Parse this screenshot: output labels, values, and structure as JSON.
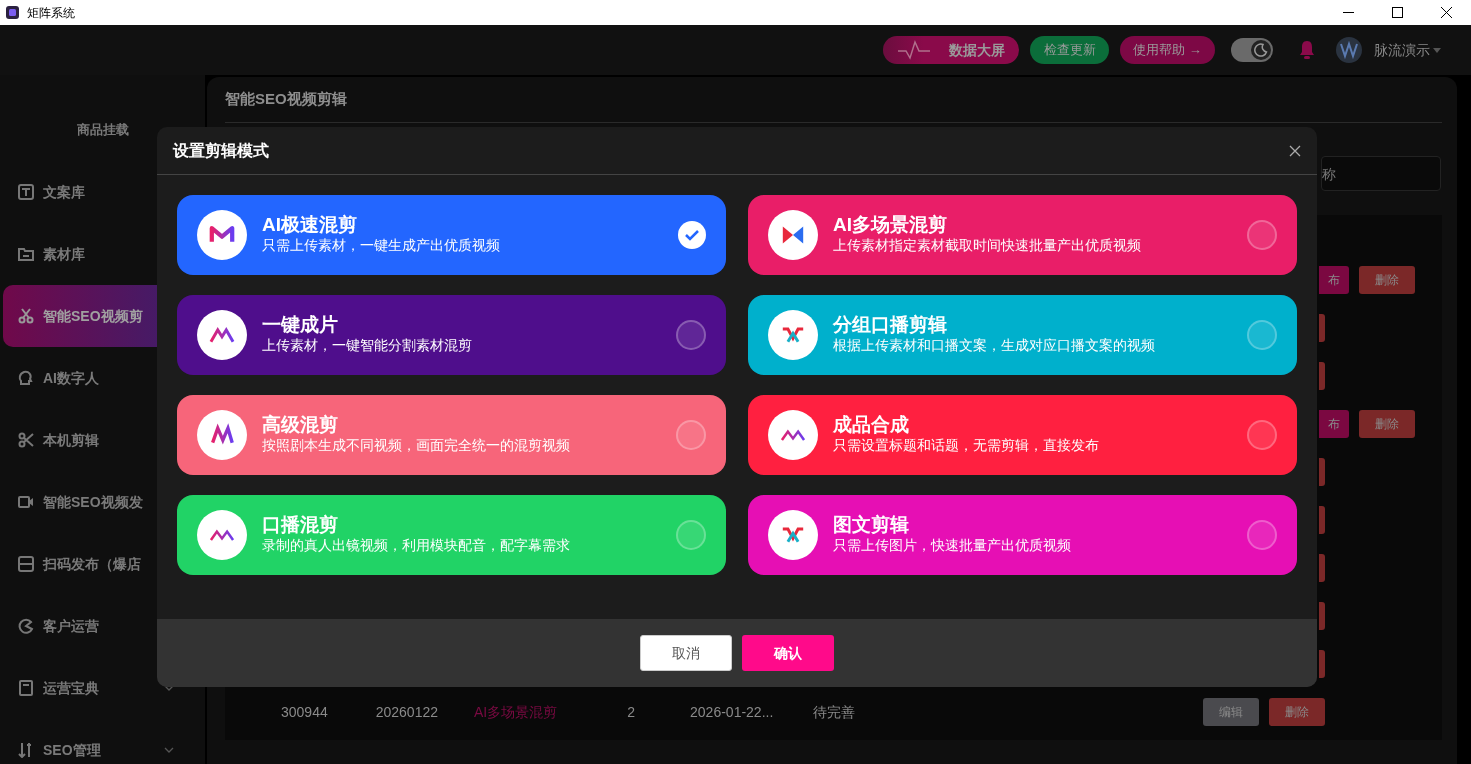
{
  "window": {
    "title": "矩阵系统"
  },
  "header": {
    "buttons": [
      {
        "label": "数据大屏",
        "kind": "dashboard"
      },
      {
        "label": "检查更新",
        "kind": "update"
      },
      {
        "label": "使用帮助 →",
        "kind": "help"
      }
    ],
    "dark_mode": true,
    "user": "脉流演示"
  },
  "sidebar": {
    "items": [
      {
        "label": "商品挂载",
        "kind": "heading",
        "selected": false
      },
      {
        "label": "文案库",
        "kind": "item",
        "selected": false
      },
      {
        "label": "素材库",
        "kind": "item",
        "selected": false
      },
      {
        "label": "智能SEO视频剪",
        "kind": "item",
        "selected": true
      },
      {
        "label": "AI数字人",
        "kind": "item",
        "selected": false
      },
      {
        "label": "本机剪辑",
        "kind": "item",
        "selected": false
      },
      {
        "label": "智能SEO视频发",
        "kind": "item",
        "selected": false
      },
      {
        "label": "扫码发布（爆店",
        "kind": "item",
        "selected": false
      },
      {
        "label": "客户运营",
        "kind": "item",
        "selected": false
      },
      {
        "label": "运营宝典",
        "kind": "group",
        "selected": false
      },
      {
        "label": "SEO管理",
        "kind": "group",
        "selected": false
      }
    ]
  },
  "page": {
    "title": "智能SEO视频剪辑",
    "search": {
      "placeholder": "称"
    },
    "rows": [
      {
        "kind": "publish",
        "buttons": [
          "布",
          "删除"
        ]
      },
      {
        "kind": "sliver"
      },
      {
        "kind": "sliver"
      },
      {
        "kind": "publish",
        "buttons": [
          "布",
          "删除"
        ]
      },
      {
        "kind": "sliver"
      },
      {
        "kind": "sliver"
      },
      {
        "kind": "sliver"
      },
      {
        "kind": "sliver"
      },
      {
        "kind": "sliver"
      },
      {
        "kind": "full",
        "cells": [
          "300944",
          "20260122",
          "AI多场景混剪",
          "2",
          "2026-01-22...",
          "待完善"
        ],
        "buttons": [
          "编辑",
          "删除"
        ]
      }
    ]
  },
  "dialog": {
    "title": "设置剪辑模式",
    "modes": [
      {
        "title": "AI极速混剪",
        "description": "只需上传素材，一键生成产出优质视频",
        "color": "#2366ff",
        "selected": true
      },
      {
        "title": "AI多场景混剪",
        "description": "上传素材指定素材截取时间快速批量产出优质视频",
        "color": "#e91e68",
        "selected": false
      },
      {
        "title": "一键成片",
        "description": "上传素材，一键智能分割素材混剪",
        "color": "#4f0e8c",
        "selected": false
      },
      {
        "title": "分组口播剪辑",
        "description": "根据上传素材和口播文案，生成对应口播文案的视频",
        "color": "#00b0cc",
        "selected": false
      },
      {
        "title": "高级混剪",
        "description": "按照剧本生成不同视频，画面完全统一的混剪视频",
        "color": "#f7657a",
        "selected": false
      },
      {
        "title": "成品合成",
        "description": "只需设置标题和话题，无需剪辑，直接发布",
        "color": "#ff2040",
        "selected": false
      },
      {
        "title": "口播混剪",
        "description": "录制的真人出镜视频，利用模块配音，配字幕需求",
        "color": "#21d366",
        "selected": false
      },
      {
        "title": "图文剪辑",
        "description": "只需上传图片，快速批量产出优质视频",
        "color": "#e60fb4",
        "selected": false
      }
    ],
    "buttons": [
      {
        "label": "取消",
        "kind": "secondary"
      },
      {
        "label": "确认",
        "kind": "primary"
      }
    ]
  }
}
